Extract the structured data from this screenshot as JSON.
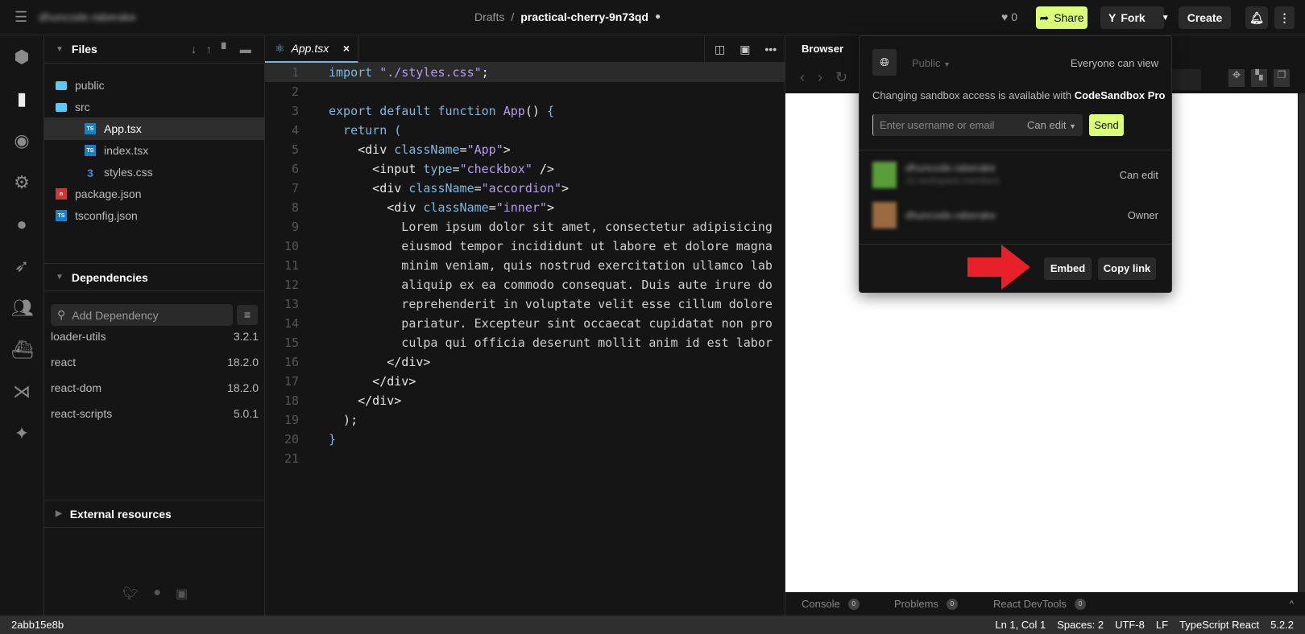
{
  "header": {
    "menu_icon": "hamburger-icon",
    "user": "dhuncode.raberake",
    "breadcrumb_parent": "Drafts",
    "breadcrumb_sep": "/",
    "sandbox_name": "practical-cherry-9n73qd",
    "likes": "0",
    "share": "Share",
    "fork": "Fork",
    "create": "Create"
  },
  "activity": [
    "cube-icon",
    "file-icon",
    "search-icon",
    "gear-icon",
    "github-icon",
    "rocket-icon",
    "users-icon",
    "docker-icon",
    "vscode-icon",
    "sparkles-icon"
  ],
  "files": {
    "title": "Files",
    "items": [
      {
        "name": "public",
        "type": "folder"
      },
      {
        "name": "src",
        "type": "folder-open"
      },
      {
        "name": "App.tsx",
        "type": "ts",
        "selected": true
      },
      {
        "name": "index.tsx",
        "type": "ts"
      },
      {
        "name": "styles.css",
        "type": "css"
      },
      {
        "name": "package.json",
        "type": "npm"
      },
      {
        "name": "tsconfig.json",
        "type": "ts"
      }
    ]
  },
  "dependencies": {
    "title": "Dependencies",
    "placeholder": "Add Dependency",
    "items": [
      {
        "name": "loader-utils",
        "version": "3.2.1"
      },
      {
        "name": "react",
        "version": "18.2.0"
      },
      {
        "name": "react-dom",
        "version": "18.2.0"
      },
      {
        "name": "react-scripts",
        "version": "5.0.1"
      }
    ]
  },
  "external": {
    "title": "External resources"
  },
  "editor": {
    "tab": "App.tsx",
    "lines": [
      [
        [
          "import",
          "k"
        ],
        [
          " \"./styles.css\"",
          "s"
        ],
        [
          ";",
          "p"
        ]
      ],
      [],
      [
        [
          "export default function ",
          "k"
        ],
        [
          "App",
          "s"
        ],
        [
          "() ",
          "p"
        ],
        [
          "{",
          "b"
        ]
      ],
      [
        [
          "  return (",
          "k"
        ]
      ],
      [
        [
          "    <div ",
          "p"
        ],
        [
          "className",
          "k"
        ],
        [
          "=",
          "p"
        ],
        [
          "\"App\"",
          "s"
        ],
        [
          ">",
          "p"
        ]
      ],
      [
        [
          "      <input ",
          "p"
        ],
        [
          "type",
          "k"
        ],
        [
          "=",
          "p"
        ],
        [
          "\"checkbox\"",
          "s"
        ],
        [
          " />",
          "p"
        ]
      ],
      [
        [
          "      <div ",
          "p"
        ],
        [
          "className",
          "k"
        ],
        [
          "=",
          "p"
        ],
        [
          "\"accordion\"",
          "s"
        ],
        [
          ">",
          "p"
        ]
      ],
      [
        [
          "        <div ",
          "p"
        ],
        [
          "className",
          "k"
        ],
        [
          "=",
          "p"
        ],
        [
          "\"inner\"",
          "s"
        ],
        [
          ">",
          "p"
        ]
      ],
      [
        [
          "          Lorem ipsum dolor sit amet, consectetur adipisicing",
          "t"
        ]
      ],
      [
        [
          "          eiusmod tempor incididunt ut labore et dolore magna",
          "t"
        ]
      ],
      [
        [
          "          minim veniam, quis nostrud exercitation ullamco lab",
          "t"
        ]
      ],
      [
        [
          "          aliquip ex ea commodo consequat. Duis aute irure do",
          "t"
        ]
      ],
      [
        [
          "          reprehenderit in voluptate velit esse cillum dolore",
          "t"
        ]
      ],
      [
        [
          "          pariatur. Excepteur sint occaecat cupidatat non pro",
          "t"
        ]
      ],
      [
        [
          "          culpa qui officia deserunt mollit anim id est labor",
          "t"
        ]
      ],
      [
        [
          "        </div>",
          "p"
        ]
      ],
      [
        [
          "      </div>",
          "p"
        ]
      ],
      [
        [
          "    </div>",
          "p"
        ]
      ],
      [
        [
          "  );",
          "p"
        ]
      ],
      [
        [
          "}",
          "b"
        ]
      ],
      []
    ]
  },
  "preview": {
    "tab": "Browser",
    "bottom_tabs": [
      {
        "label": "Console",
        "count": "0"
      },
      {
        "label": "Problems",
        "count": "0"
      },
      {
        "label": "React DevTools",
        "count": "0"
      }
    ]
  },
  "share_popup": {
    "visibility": "Public",
    "visibility_desc": "Everyone can view",
    "notice": "Changing sandbox access is available with ",
    "notice_strong": "CodeSandbox Pro",
    "input_placeholder": "Enter username or email",
    "permission": "Can edit",
    "send": "Send",
    "members": [
      {
        "name": "dhuncode.raberake",
        "sub": "10 workspace members",
        "role": "Can edit"
      },
      {
        "name": "dhuncode.raberake",
        "role": "Owner"
      }
    ],
    "embed": "Embed",
    "copy_link": "Copy link"
  },
  "status": {
    "commit": "2abb15e8b",
    "position": "Ln 1, Col 1",
    "spaces": "Spaces: 2",
    "encoding": "UTF-8",
    "eol": "LF",
    "language": "TypeScript React",
    "version": "5.2.2"
  },
  "colors": {
    "accent": "#dcff7a",
    "arrow": "#e8202a"
  }
}
